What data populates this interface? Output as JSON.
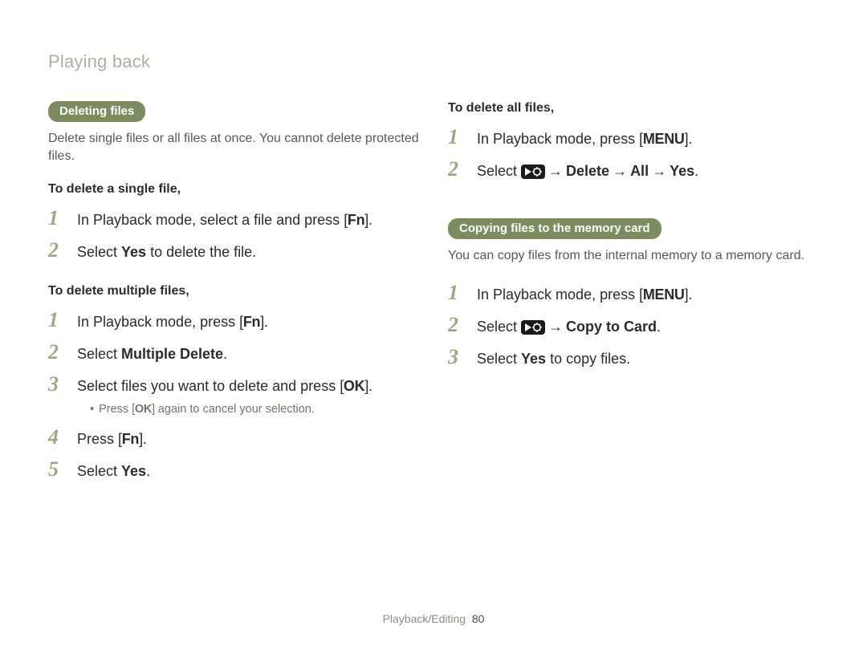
{
  "header": "Playing back",
  "left": {
    "section_pill": "Deleting files",
    "intro": "Delete single files or all files at once. You cannot delete protected files.",
    "single": {
      "heading": "To delete a single file,",
      "step1_a": "In Playback mode, select a file and press ",
      "step1_key": "Fn",
      "step1_b": ".",
      "step2_a": "Select ",
      "step2_bold": "Yes",
      "step2_b": " to delete the file."
    },
    "multiple": {
      "heading": "To delete multiple files,",
      "step1_a": "In Playback mode, press ",
      "step1_key": "Fn",
      "step1_b": ".",
      "step2_a": "Select ",
      "step2_bold": "Multiple Delete",
      "step2_b": ".",
      "step3_a": "Select files you want to delete and press ",
      "step3_key": "OK",
      "step3_b": ".",
      "step3_note_a": "Press ",
      "step3_note_key": "OK",
      "step3_note_b": " again to cancel your selection.",
      "step4_a": "Press ",
      "step4_key": "Fn",
      "step4_b": ".",
      "step5_a": "Select ",
      "step5_bold": "Yes",
      "step5_b": "."
    }
  },
  "right": {
    "delete_all": {
      "heading": "To delete all files,",
      "step1_a": "In Playback mode, press ",
      "step1_key": "MENU",
      "step1_b": ".",
      "step2_a": "Select ",
      "step2_arrow": " → ",
      "step2_path1": "Delete",
      "step2_path2": "All",
      "step2_path3": "Yes",
      "step2_b": "."
    },
    "copy": {
      "pill": "Copying files to the memory card",
      "intro": "You can copy files from the internal memory to a memory card.",
      "step1_a": "In Playback mode, press ",
      "step1_key": "MENU",
      "step1_b": ".",
      "step2_a": "Select ",
      "step2_arrow": " → ",
      "step2_bold": "Copy to Card",
      "step2_b": ".",
      "step3_a": "Select ",
      "step3_bold": "Yes",
      "step3_b": " to copy files."
    }
  },
  "footer": {
    "section": "Playback/Editing",
    "page": "80"
  },
  "numbers": {
    "n1": "1",
    "n2": "2",
    "n3": "3",
    "n4": "4",
    "n5": "5"
  },
  "bullet": "•"
}
